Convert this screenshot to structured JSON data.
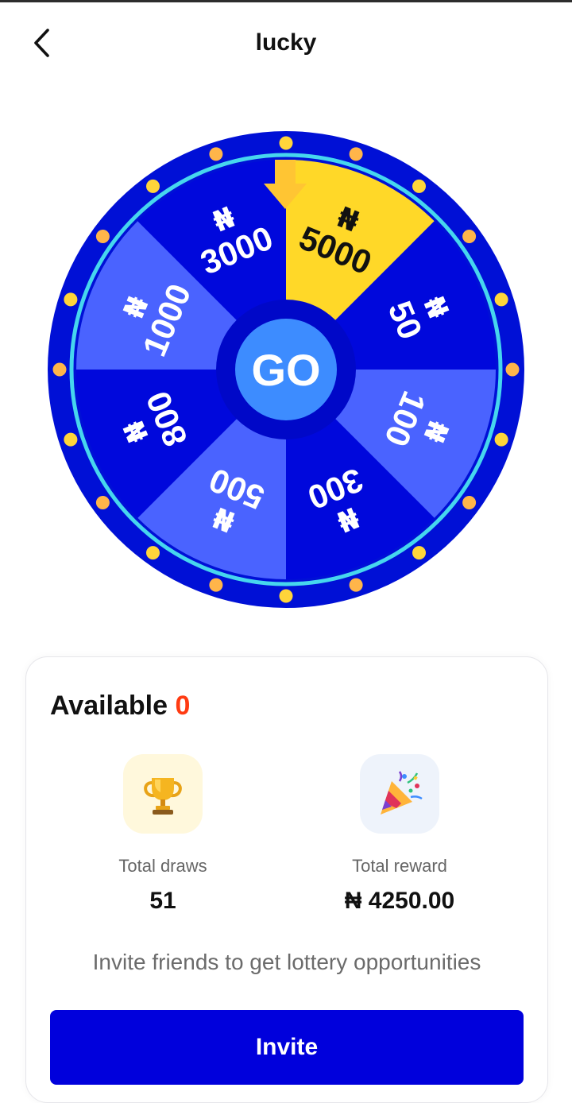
{
  "header": {
    "title": "lucky",
    "back_icon": "chevron-left-icon"
  },
  "wheel": {
    "center_label": "GO",
    "segments": [
      {
        "label": "5000",
        "currency": "₦",
        "color": "#ffd828",
        "text_color": "#111111"
      },
      {
        "label": "50",
        "currency": "₦",
        "color": "#0008dc",
        "text_color": "#ffffff"
      },
      {
        "label": "100",
        "currency": "₦",
        "color": "#4a63ff",
        "text_color": "#ffffff"
      },
      {
        "label": "300",
        "currency": "₦",
        "color": "#0008dc",
        "text_color": "#ffffff"
      },
      {
        "label": "500",
        "currency": "₦",
        "color": "#4a63ff",
        "text_color": "#ffffff"
      },
      {
        "label": "800",
        "currency": "₦",
        "color": "#0008dc",
        "text_color": "#ffffff"
      },
      {
        "label": "1000",
        "currency": "₦",
        "color": "#4a63ff",
        "text_color": "#ffffff"
      },
      {
        "label": "3000",
        "currency": "₦",
        "color": "#0008dc",
        "text_color": "#ffffff"
      }
    ],
    "colors": {
      "rim": "#0010d6",
      "ring": "#46d6ee",
      "hub": "#0008c8",
      "go_button": "#3d8cff",
      "pointer": "#ffc533",
      "dot_yellow": "#ffd53a",
      "dot_orange": "#ffb54a"
    }
  },
  "card": {
    "available_label": "Available",
    "available_count": "0",
    "stats": [
      {
        "icon": "trophy-icon",
        "label": "Total draws",
        "value": "51"
      },
      {
        "icon": "party-popper-icon",
        "label": "Total reward",
        "value": "₦ 4250.00"
      }
    ],
    "invite_text": "Invite friends to get lottery opportunities",
    "invite_button": "Invite"
  }
}
